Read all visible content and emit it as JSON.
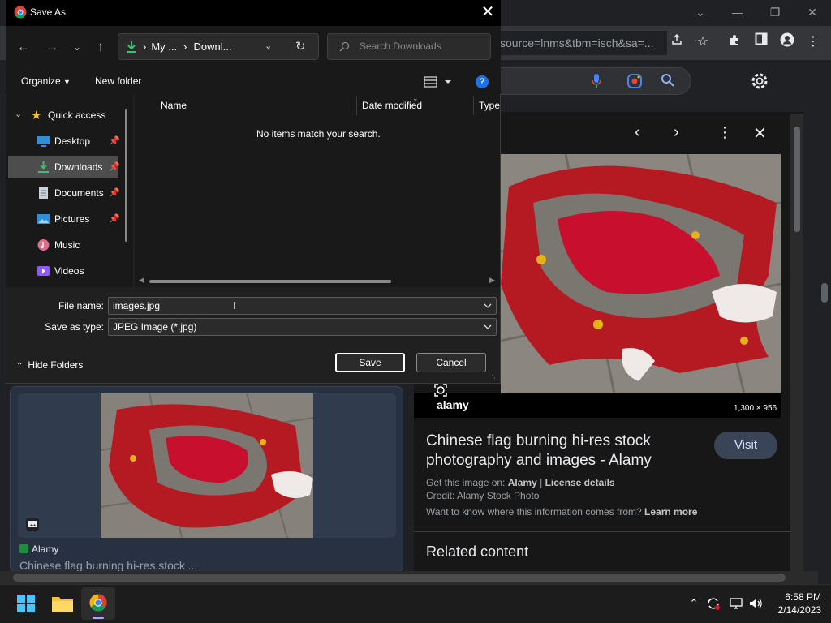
{
  "browser": {
    "url_fragment": "source=lnms&tbm=isch&sa=...",
    "window_controls": [
      "chevron-down",
      "minimize",
      "restore",
      "close"
    ]
  },
  "preview": {
    "dimensions": "1,300 × 956",
    "watermark": "alamy",
    "title": "Chinese flag burning hi-res stock photography and images - Alamy",
    "visit_label": "Visit",
    "get_image_prefix": "Get this image on:",
    "get_image_source": "Alamy",
    "license_details": "License details",
    "credit": "Credit: Alamy Stock Photo",
    "info_question": "Want to know where this information comes from?",
    "learn_more": "Learn more",
    "related_heading": "Related content"
  },
  "card": {
    "source": "Alamy",
    "title": "Chinese flag burning hi-res stock ..."
  },
  "dialog": {
    "title": "Save As",
    "breadcrumb": [
      "My ...",
      "Downl..."
    ],
    "search_placeholder": "Search Downloads",
    "organize_label": "Organize",
    "new_folder_label": "New folder",
    "nav_items": [
      {
        "label": "Quick access",
        "icon": "star-icon"
      },
      {
        "label": "Desktop",
        "icon": "desktop-icon"
      },
      {
        "label": "Downloads",
        "icon": "download-icon"
      },
      {
        "label": "Documents",
        "icon": "documents-icon"
      },
      {
        "label": "Pictures",
        "icon": "pictures-icon"
      },
      {
        "label": "Music",
        "icon": "music-icon"
      },
      {
        "label": "Videos",
        "icon": "videos-icon"
      }
    ],
    "columns": [
      "Name",
      "Date modified",
      "Type"
    ],
    "empty_message": "No items match your search.",
    "file_name_label": "File name:",
    "file_name_value": "images.jpg",
    "save_type_label": "Save as type:",
    "save_type_value": "JPEG Image (*.jpg)",
    "hide_folders_label": "Hide Folders",
    "save_label": "Save",
    "cancel_label": "Cancel"
  },
  "taskbar": {
    "time": "6:58 PM",
    "date": "2/14/2023"
  },
  "colors": {
    "accent_blue": "#1a73e8",
    "visit_button": "#394457",
    "flag_red": "#c8102e"
  }
}
